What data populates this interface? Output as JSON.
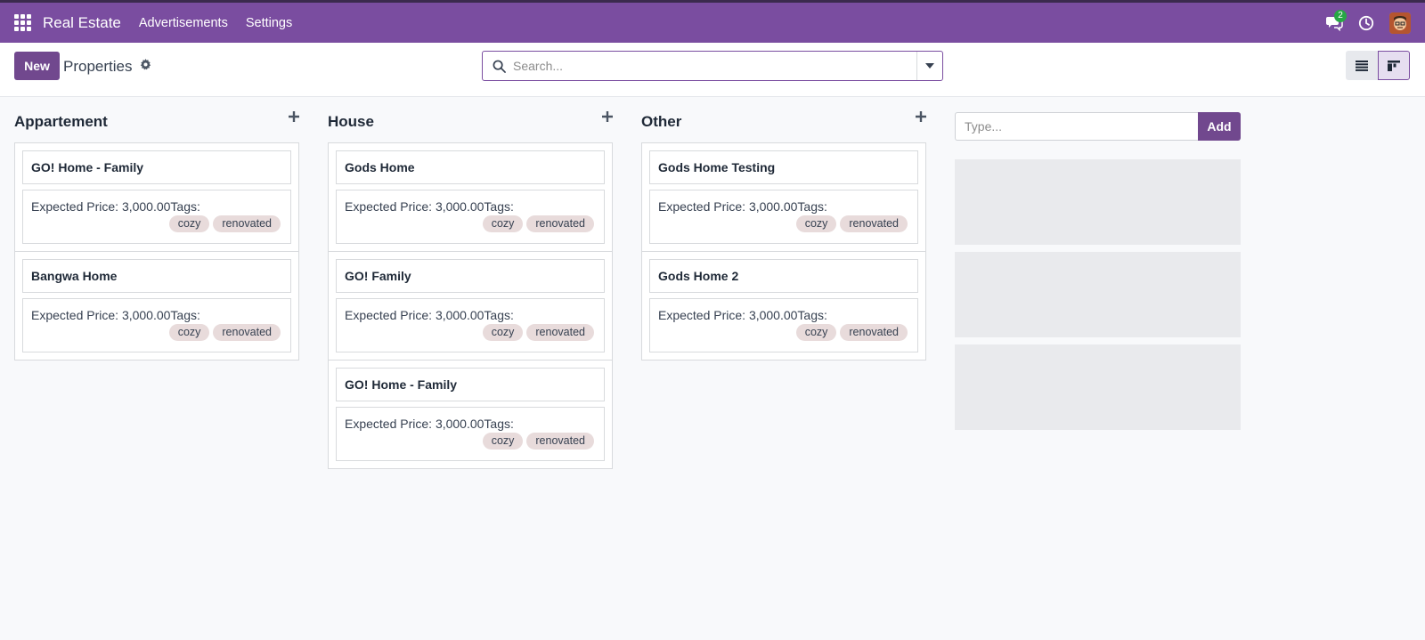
{
  "navbar": {
    "app_name": "Real Estate",
    "menu": [
      "Advertisements",
      "Settings"
    ],
    "chat_count": "2",
    "icons": [
      "apps-grid-icon",
      "chat-icon",
      "clock-icon",
      "avatar"
    ]
  },
  "control_panel": {
    "new_label": "New",
    "title": "Properties",
    "search_placeholder": "Search..."
  },
  "columns": [
    {
      "title": "Appartement",
      "records": [
        {
          "name": "GO! Home - Family",
          "price": "Expected Price: 3,000.00Tags:",
          "tags": [
            "cozy",
            "renovated"
          ]
        },
        {
          "name": "Bangwa Home",
          "price": "Expected Price: 3,000.00Tags:",
          "tags": [
            "cozy",
            "renovated"
          ]
        }
      ]
    },
    {
      "title": "House",
      "records": [
        {
          "name": "Gods Home",
          "price": "Expected Price: 3,000.00Tags:",
          "tags": [
            "cozy",
            "renovated"
          ]
        },
        {
          "name": "GO! Family",
          "price": "Expected Price: 3,000.00Tags:",
          "tags": [
            "cozy",
            "renovated"
          ]
        },
        {
          "name": "GO! Home - Family",
          "price": "Expected Price: 3,000.00Tags:",
          "tags": [
            "cozy",
            "renovated"
          ]
        }
      ]
    },
    {
      "title": "Other",
      "records": [
        {
          "name": "Gods Home Testing",
          "price": "Expected Price: 3,000.00Tags:",
          "tags": [
            "cozy",
            "renovated"
          ]
        },
        {
          "name": "Gods Home 2",
          "price": "Expected Price: 3,000.00Tags:",
          "tags": [
            "cozy",
            "renovated"
          ]
        }
      ]
    }
  ],
  "quick_create": {
    "placeholder": "Type...",
    "add_label": "Add"
  },
  "colors": {
    "brand": "#7a4da0",
    "primary_button": "#71488e",
    "tag_bg": "#e8dbdb",
    "badge": "#28a745"
  }
}
